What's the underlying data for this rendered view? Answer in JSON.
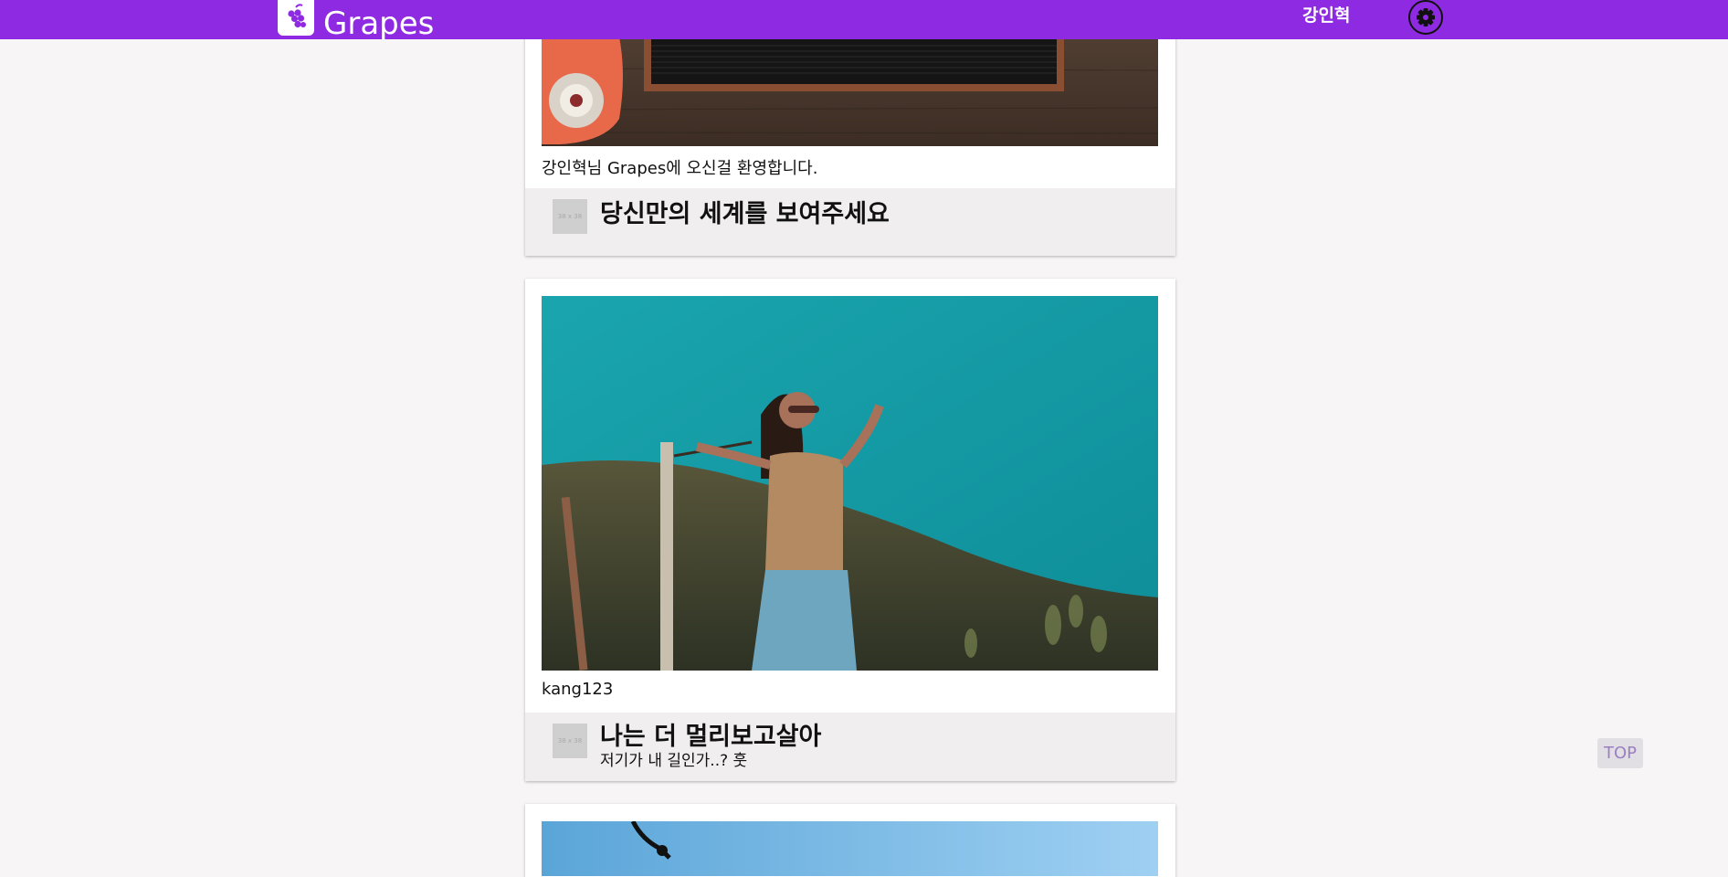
{
  "header": {
    "brand": "Grapes",
    "username": "강인혁",
    "brand_color": "#8e2be2"
  },
  "posts": [
    {
      "caption": "강인혁님 Grapes에 오신걸 환영합니다.",
      "title": "당신만의 세계를 보여주세요",
      "subtitle": "",
      "thumb_label": "38 x 38"
    },
    {
      "caption": "kang123",
      "title": "나는 더 멀리보고살아",
      "subtitle": "저기가 내 길인가..? 훗",
      "thumb_label": "38 x 38"
    }
  ],
  "top_button": "TOP"
}
